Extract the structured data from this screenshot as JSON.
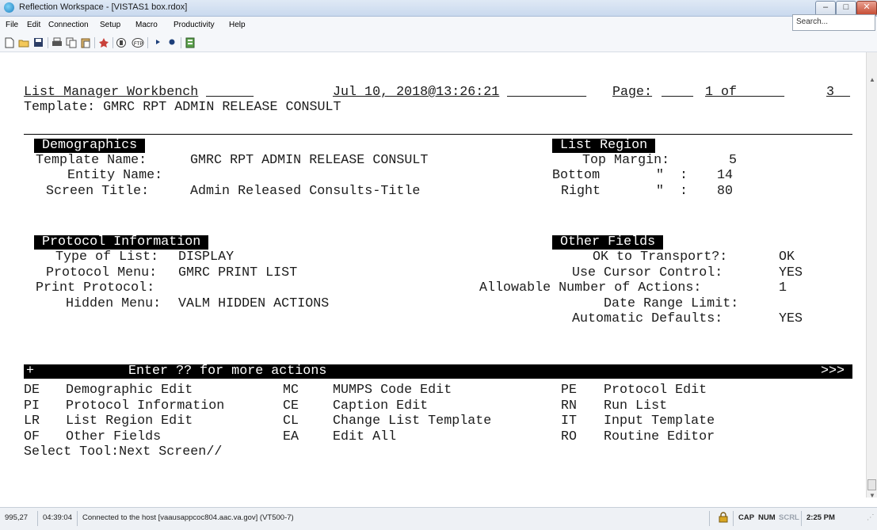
{
  "window": {
    "title": "Reflection Workspace - [VISTAS1 box.rdox]",
    "minimize": "–",
    "maximize": "□",
    "close": "✕"
  },
  "menu": [
    "File",
    "Edit",
    "Connection",
    "Setup",
    "Macro",
    "Productivity",
    "Help"
  ],
  "search": {
    "placeholder": "Search..."
  },
  "toolbar_icons": [
    "new-file-icon",
    "open-folder-icon",
    "save-icon",
    "print-icon",
    "copy-icon",
    "paste-icon",
    "macro-icon",
    "clipboard-icon",
    "ftp-icon",
    "play-icon",
    "record-icon",
    "quick-keys-icon"
  ],
  "screen": {
    "header_left": "List Manager Workbench",
    "header_date": "Jul 10, 2018@13:26:21",
    "header_page_label": "Page:",
    "header_page_num": "1",
    "header_page_of": "of",
    "header_page_total": "3",
    "template_line": "Template: GMRC RPT ADMIN RELEASE CONSULT",
    "demographics": {
      "heading": "Demographics",
      "template_name_label": "Template Name:",
      "template_name_value": "GMRC RPT ADMIN RELEASE CONSULT",
      "entity_name_label": "Entity Name:",
      "screen_title_label": "Screen Title:",
      "screen_title_value": "Admin Released Consults-Title"
    },
    "list_region": {
      "heading": "List Region",
      "top_margin_label": "Top Margin:",
      "top_margin_value": "5",
      "bottom_label": "Bottom",
      "bottom_ditto": "\"  :",
      "bottom_value": "14",
      "right_label": "Right",
      "right_ditto": "\"  :",
      "right_value": "80"
    },
    "protocol": {
      "heading": "Protocol Information",
      "type_label": "Type of List:",
      "type_value": "DISPLAY",
      "menu_label": "Protocol Menu:",
      "menu_value": "GMRC PRINT LIST",
      "print_label": "Print Protocol:",
      "hidden_label": "Hidden Menu:",
      "hidden_value": "VALM HIDDEN ACTIONS"
    },
    "other_fields": {
      "heading": "Other Fields",
      "ok_transport_label": "OK to Transport?:",
      "ok_transport_value": "OK",
      "cursor_label": "Use Cursor Control:",
      "cursor_value": "YES",
      "allowable_label": "Allowable Number of Actions:",
      "allowable_value": "1",
      "date_range_label": "Date Range Limit:",
      "auto_defaults_label": "Automatic Defaults:",
      "auto_defaults_value": "YES"
    },
    "action_bar": {
      "plus": "+",
      "text": "Enter ?? for more actions",
      "more": ">>>"
    },
    "actions": [
      [
        {
          "code": "DE",
          "label": "Demographic Edit"
        },
        {
          "code": "MC",
          "label": "MUMPS Code Edit"
        },
        {
          "code": "PE",
          "label": "Protocol Edit"
        }
      ],
      [
        {
          "code": "PI",
          "label": "Protocol Information"
        },
        {
          "code": "CE",
          "label": "Caption Edit"
        },
        {
          "code": "RN",
          "label": "Run List"
        }
      ],
      [
        {
          "code": "LR",
          "label": "List Region Edit"
        },
        {
          "code": "CL",
          "label": "Change List Template"
        },
        {
          "code": "IT",
          "label": "Input Template"
        }
      ],
      [
        {
          "code": "OF",
          "label": "Other Fields"
        },
        {
          "code": "EA",
          "label": "Edit All"
        },
        {
          "code": "RO",
          "label": "Routine Editor"
        }
      ]
    ],
    "prompt": "Select Tool:Next Screen//"
  },
  "status": {
    "cursor_pos": "995,27",
    "elapsed": "04:39:04",
    "connection": "Connected to the host [vaausappcoc804.aac.va.gov] (VT500-7)",
    "cap": "CAP",
    "num": "NUM",
    "scrl": "SCRL",
    "clock": "2:25 PM"
  }
}
